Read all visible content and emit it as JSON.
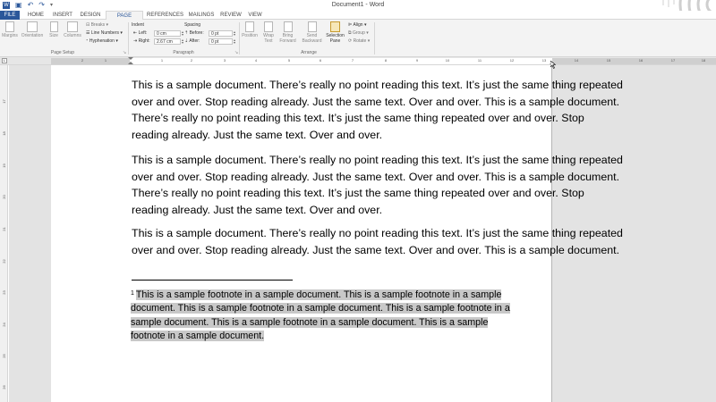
{
  "window": {
    "title": "Document1 - Word",
    "qat": [
      {
        "name": "word-logo-icon",
        "glyph": "W"
      },
      {
        "name": "save-icon",
        "glyph": "▣"
      },
      {
        "name": "undo-icon",
        "glyph": "↶"
      },
      {
        "name": "redo-icon",
        "glyph": "↷"
      }
    ]
  },
  "tabs": {
    "file": "FILE",
    "home": "HOME",
    "insert": "INSERT",
    "design": "DESIGN",
    "page_layout": "PAGE LAYOUT",
    "references": "REFERENCES",
    "mailings": "MAILINGS",
    "review": "REVIEW",
    "view": "VIEW"
  },
  "ribbon": {
    "margins": "Margins",
    "orientation": "Orientation",
    "size": "Size",
    "columns": "Columns",
    "breaks": "Breaks",
    "line_numbers": "Line Numbers",
    "hyphenation": "Hyphenation",
    "page_setup_group": "Page Setup",
    "indent_label": "Indent",
    "left_label": "Left:",
    "left_value": "0 cm",
    "right_label": "Right:",
    "right_value": "2.67 cm",
    "spacing_label": "Spacing",
    "before_label": "Before:",
    "before_value": "0 pt",
    "after_label": "After:",
    "after_value": "0 pt",
    "paragraph_group": "Paragraph",
    "position": "Position",
    "wrap_text": "Wrap Text",
    "bring_forward": "Bring Forward",
    "send_backward": "Send Backward",
    "selection_pane": "Selection Pane",
    "align": "Align",
    "group": "Group",
    "rotate": "Rotate",
    "arrange_group": "Arrange"
  },
  "ruler": {
    "h_numbers": [
      "2",
      "1",
      "1",
      "2",
      "3",
      "4",
      "5",
      "6",
      "7",
      "8",
      "9",
      "10",
      "11",
      "12",
      "13",
      "14",
      "15",
      "16",
      "17",
      "18"
    ],
    "v_numbers": [
      "17",
      "18",
      "19",
      "20",
      "21",
      "22",
      "23",
      "24",
      "25",
      "26"
    ]
  },
  "document": {
    "p1_lines": [
      "This is a sample document. There’s really no point reading this text. It’s just the same thing repeated",
      "over and over. Stop reading already. Just the same text. Over and over. This is a sample document.",
      "There’s really no point reading this text. It’s just the same thing repeated over and over. Stop",
      "reading already. Just the same text. Over and over."
    ],
    "p2_lines": [
      "This is a sample document. There’s really no point reading this text. It’s just the same thing repeated",
      "over and over. Stop reading already. Just the same text. Over and over. This is a sample document.",
      "There’s really no point reading this text. It’s just the same thing repeated over and over. Stop",
      "reading already. Just the same text. Over and over."
    ],
    "p3_lines": [
      "This is a sample document. There’s really no point reading this text. It’s just the same thing repeated",
      "over and over. Stop reading already. Just the same text. Over and over. This is a sample document."
    ],
    "footnote_number": "1",
    "footnote_lines": [
      "This is a sample footnote in a sample document. This is a sample footnote in a sample",
      "document. This is a sample footnote in a sample document. This is a sample footnote in a",
      "sample document. This is a sample footnote in a sample document. This is a sample",
      "footnote in a sample document."
    ]
  },
  "colors": {
    "accent": "#2b579a",
    "ribbon_bg": "#f3f3f3",
    "canvas_bg": "#e3e3e3",
    "selection": "#c8c8c8"
  }
}
